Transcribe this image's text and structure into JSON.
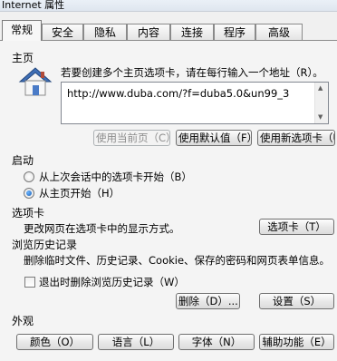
{
  "window": {
    "title": "Internet 属性"
  },
  "tabs": [
    {
      "label": "常规",
      "active": true
    },
    {
      "label": "安全"
    },
    {
      "label": "隐私"
    },
    {
      "label": "内容"
    },
    {
      "label": "连接"
    },
    {
      "label": "程序"
    },
    {
      "label": "高级"
    }
  ],
  "home": {
    "heading": "主页",
    "instruction": "若要创建多个主页选项卡，请在每行输入一个地址（R）。",
    "url": "http://www.duba.com/?f=duba5.0&un99_3",
    "buttons": {
      "use_current": "使用当前页（C）",
      "use_default": "使用默认值（F）",
      "use_new_tab": "使用新选项卡（U）"
    }
  },
  "startup": {
    "heading": "启动",
    "options": [
      {
        "label": "从上次会话中的选项卡开始（B）",
        "checked": false
      },
      {
        "label": "从主页开始（H）",
        "checked": true
      }
    ]
  },
  "tabs_section": {
    "heading": "选项卡",
    "description": "更改网页在选项卡中的显示方式。",
    "button": "选项卡（T）"
  },
  "history": {
    "heading": "浏览历史记录",
    "description": "删除临时文件、历史记录、Cookie、保存的密码和网页表单信息。",
    "checkbox_label": "退出时删除浏览历史记录（W）",
    "checkbox_checked": false,
    "delete_button": "删除（D）...",
    "settings_button": "设置（S）"
  },
  "appearance": {
    "heading": "外观",
    "buttons": [
      "颜色（O）",
      "语言（L）",
      "字体（N）",
      "辅助功能（E）"
    ]
  },
  "colors": {
    "accent": "#1a5fb4",
    "disabled_text": "#8c8c8c"
  }
}
